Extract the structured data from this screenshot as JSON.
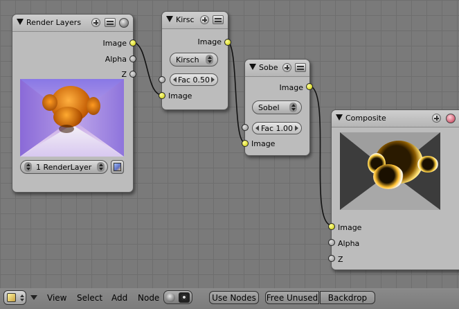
{
  "nodes": {
    "render_layers": {
      "title": "Render Layers",
      "outputs": [
        "Image",
        "Alpha",
        "Z"
      ],
      "layer_select": "1 RenderLayer"
    },
    "kirsch": {
      "title": "Kirsc",
      "output": "Image",
      "filter_type": "Kirsch",
      "fac": "Fac 0.50",
      "input": "Image"
    },
    "sobel": {
      "title": "Sobe",
      "output": "Image",
      "filter_type": "Sobel",
      "fac": "Fac 1.00",
      "input": "Image"
    },
    "composite": {
      "title": "Composite",
      "inputs": [
        "Image",
        "Alpha",
        "Z"
      ]
    }
  },
  "toolbar": {
    "menus": [
      "View",
      "Select",
      "Add",
      "Node"
    ],
    "use_nodes": "Use Nodes",
    "free_unused": "Free Unused",
    "backdrop": "Backdrop"
  },
  "colors": {
    "socket_image": "#d8d800",
    "socket_value": "#a0a0a0",
    "background": "#7a7a7a"
  }
}
